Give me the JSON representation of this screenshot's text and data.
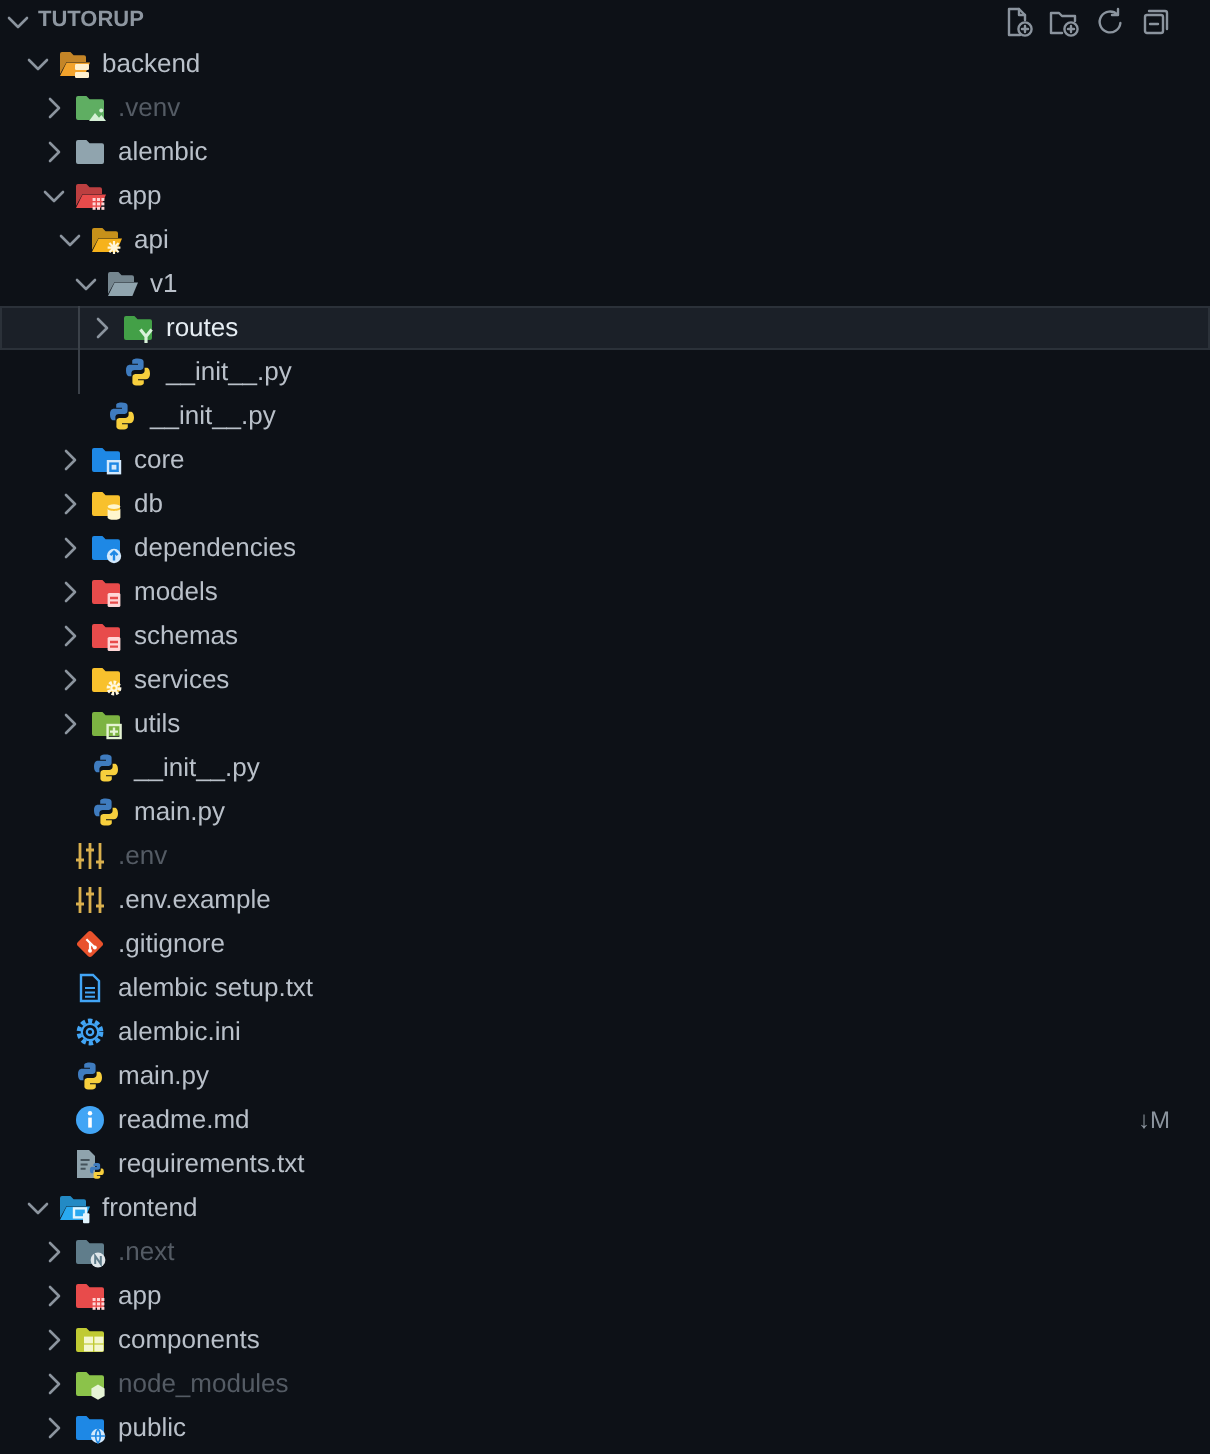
{
  "explorer": {
    "title": "TUTORUP",
    "expanded": true,
    "tree": [
      {
        "name": "backend",
        "kind": "server",
        "expanded": true,
        "selected": false,
        "ignored": false,
        "children": [
          {
            "name": ".venv",
            "kind": "venv",
            "expanded": false,
            "selected": false,
            "ignored": true
          },
          {
            "name": "alembic",
            "kind": "folder",
            "expanded": false,
            "selected": false,
            "ignored": false
          },
          {
            "name": "app",
            "kind": "grid",
            "expanded": true,
            "selected": false,
            "ignored": false,
            "children": [
              {
                "name": "api",
                "kind": "api",
                "expanded": true,
                "selected": false,
                "ignored": false,
                "children": [
                  {
                    "name": "v1",
                    "kind": "folder",
                    "expanded": true,
                    "selected": false,
                    "ignored": false,
                    "children": [
                      {
                        "name": "routes",
                        "kind": "routes",
                        "expanded": false,
                        "selected": true,
                        "ignored": false
                      },
                      {
                        "name": "__init__.py",
                        "kind": "python",
                        "selected": false,
                        "ignored": false
                      }
                    ]
                  },
                  {
                    "name": "__init__.py",
                    "kind": "python",
                    "selected": false,
                    "ignored": false
                  }
                ]
              },
              {
                "name": "core",
                "kind": "core",
                "expanded": false,
                "selected": false,
                "ignored": false
              },
              {
                "name": "db",
                "kind": "database",
                "expanded": false,
                "selected": false,
                "ignored": false
              },
              {
                "name": "dependencies",
                "kind": "dependencies",
                "expanded": false,
                "selected": false,
                "ignored": false
              },
              {
                "name": "models",
                "kind": "models",
                "expanded": false,
                "selected": false,
                "ignored": false
              },
              {
                "name": "schemas",
                "kind": "schemas",
                "expanded": false,
                "selected": false,
                "ignored": false
              },
              {
                "name": "services",
                "kind": "services",
                "expanded": false,
                "selected": false,
                "ignored": false
              },
              {
                "name": "utils",
                "kind": "utils",
                "expanded": false,
                "selected": false,
                "ignored": false
              },
              {
                "name": "__init__.py",
                "kind": "python",
                "selected": false,
                "ignored": false
              },
              {
                "name": "main.py",
                "kind": "python",
                "selected": false,
                "ignored": false
              }
            ]
          },
          {
            "name": ".env",
            "kind": "env",
            "selected": false,
            "ignored": true
          },
          {
            "name": ".env.example",
            "kind": "env",
            "selected": false,
            "ignored": false
          },
          {
            "name": ".gitignore",
            "kind": "git",
            "selected": false,
            "ignored": false
          },
          {
            "name": "alembic setup.txt",
            "kind": "text",
            "selected": false,
            "ignored": false
          },
          {
            "name": "alembic.ini",
            "kind": "settings",
            "selected": false,
            "ignored": false
          },
          {
            "name": "main.py",
            "kind": "python",
            "selected": false,
            "ignored": false
          },
          {
            "name": "readme.md",
            "kind": "info",
            "selected": false,
            "ignored": false,
            "status": "↓M"
          },
          {
            "name": "requirements.txt",
            "kind": "requirements",
            "selected": false,
            "ignored": false
          }
        ]
      },
      {
        "name": "frontend",
        "kind": "devices",
        "expanded": true,
        "selected": false,
        "ignored": false,
        "children": [
          {
            "name": ".next",
            "kind": "next",
            "expanded": false,
            "selected": false,
            "ignored": true
          },
          {
            "name": "app",
            "kind": "grid",
            "expanded": false,
            "selected": false,
            "ignored": false
          },
          {
            "name": "components",
            "kind": "components",
            "expanded": false,
            "selected": false,
            "ignored": false
          },
          {
            "name": "node_modules",
            "kind": "modules",
            "expanded": false,
            "selected": false,
            "ignored": true
          },
          {
            "name": "public",
            "kind": "public",
            "expanded": false,
            "selected": false,
            "ignored": false
          }
        ]
      }
    ]
  }
}
